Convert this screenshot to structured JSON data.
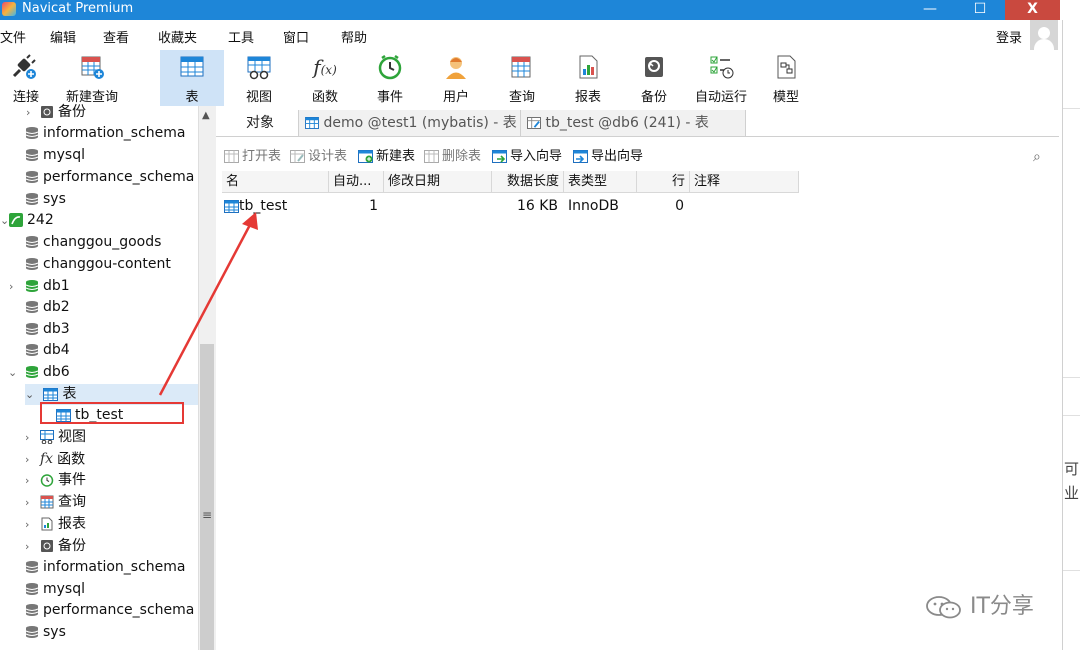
{
  "window": {
    "title": "Navicat Premium",
    "min": "—",
    "max": "☐",
    "close": "X"
  },
  "menubar": {
    "items": [
      "文件",
      "编辑",
      "查看",
      "收藏夹",
      "工具",
      "窗口",
      "帮助"
    ],
    "login": "登录"
  },
  "toolbar": {
    "items": [
      {
        "label": "连接",
        "icon": "plug-icon"
      },
      {
        "label": "新建查询",
        "icon": "new-query-icon"
      },
      {
        "label": "表",
        "icon": "table-icon",
        "active": true
      },
      {
        "label": "视图",
        "icon": "view-icon"
      },
      {
        "label": "函数",
        "icon": "function-icon"
      },
      {
        "label": "事件",
        "icon": "clock-icon"
      },
      {
        "label": "用户",
        "icon": "user-icon"
      },
      {
        "label": "查询",
        "icon": "query-icon"
      },
      {
        "label": "报表",
        "icon": "report-icon"
      },
      {
        "label": "备份",
        "icon": "backup-icon"
      },
      {
        "label": "自动运行",
        "icon": "automation-icon"
      },
      {
        "label": "模型",
        "icon": "model-icon"
      }
    ]
  },
  "sidebar": {
    "items": [
      {
        "label": "备份",
        "kind": "folder"
      },
      {
        "label": "information_schema",
        "kind": "db-gray"
      },
      {
        "label": "mysql",
        "kind": "db-gray"
      },
      {
        "label": "performance_schema",
        "kind": "db-gray"
      },
      {
        "label": "sys",
        "kind": "db-gray"
      },
      {
        "label": "242",
        "kind": "connection"
      },
      {
        "label": "changgou_goods",
        "kind": "db-gray"
      },
      {
        "label": "changgou-content",
        "kind": "db-gray"
      },
      {
        "label": "db1",
        "kind": "db-green"
      },
      {
        "label": "db2",
        "kind": "db-gray"
      },
      {
        "label": "db3",
        "kind": "db-gray"
      },
      {
        "label": "db4",
        "kind": "db-gray"
      },
      {
        "label": "db6",
        "kind": "db-green"
      },
      {
        "label": "表",
        "kind": "tables"
      },
      {
        "label": "tb_test",
        "kind": "table"
      },
      {
        "label": "视图",
        "kind": "views"
      },
      {
        "label": "函数",
        "kind": "functions"
      },
      {
        "label": "事件",
        "kind": "events"
      },
      {
        "label": "查询",
        "kind": "queries"
      },
      {
        "label": "报表",
        "kind": "reports"
      },
      {
        "label": "备份",
        "kind": "backups"
      },
      {
        "label": "information_schema",
        "kind": "db-gray"
      },
      {
        "label": "mysql",
        "kind": "db-gray"
      },
      {
        "label": "performance_schema",
        "kind": "db-gray"
      },
      {
        "label": "sys",
        "kind": "db-gray"
      }
    ]
  },
  "tabs": [
    {
      "label": "对象"
    },
    {
      "label": "demo @test1 (mybatis) - 表"
    },
    {
      "label": "tb_test @db6 (241) - 表"
    }
  ],
  "objectbar": {
    "buttons": [
      {
        "label": "打开表",
        "enabled": false
      },
      {
        "label": "设计表",
        "enabled": false
      },
      {
        "label": "新建表",
        "enabled": true
      },
      {
        "label": "删除表",
        "enabled": false
      },
      {
        "label": "导入向导",
        "enabled": true
      },
      {
        "label": "导出向导",
        "enabled": true
      }
    ]
  },
  "grid": {
    "columns": [
      "名",
      "自动...",
      "修改日期",
      "数据长度",
      "表类型",
      "行",
      "注释"
    ],
    "rows": [
      {
        "name": "tb_test",
        "auto": "1",
        "modified": "",
        "size": "16 KB",
        "engine": "InnoDB",
        "rows": "0",
        "comment": ""
      }
    ]
  },
  "right_strip": {
    "glyphs": [
      "可",
      "业"
    ]
  },
  "watermark": "IT分享",
  "colors": {
    "titlebar": "#1e86d8",
    "active_toolbar": "#cfe3f7",
    "annotation": "#e53935",
    "db_green": "#2ea43a"
  }
}
